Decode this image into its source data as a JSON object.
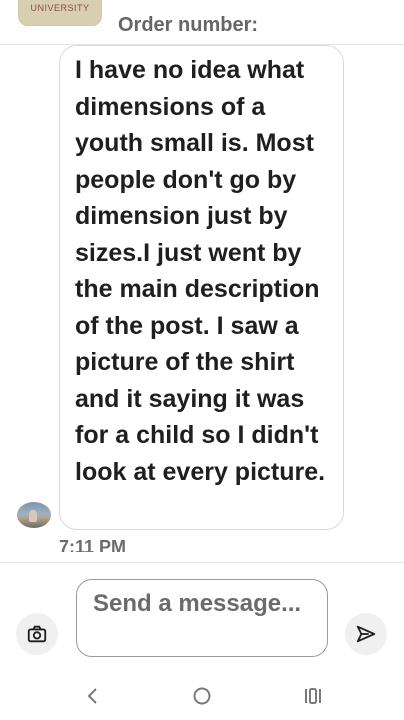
{
  "header": {
    "thumbnail_text": "UNIVERSITY",
    "order_label": "Order number:"
  },
  "message": {
    "text": "I have no idea what dimensions of a youth small is. Most people don't go by dimension just by sizes.I just went by the main description of the post. I saw a picture of the shirt and it saying it was for a child so I didn't look at every picture.",
    "timestamp": "7:11 PM"
  },
  "composer": {
    "placeholder": "Send a message...",
    "camera_icon": "camera-icon",
    "send_icon": "send-icon"
  },
  "navbar": {
    "back_icon": "back-icon",
    "home_icon": "home-icon",
    "recents_icon": "recents-icon"
  },
  "colors": {
    "text": "#1f1f1f",
    "muted": "#6b6b6b",
    "border": "#d9d9d9",
    "button_bg": "#f0f0f0"
  }
}
